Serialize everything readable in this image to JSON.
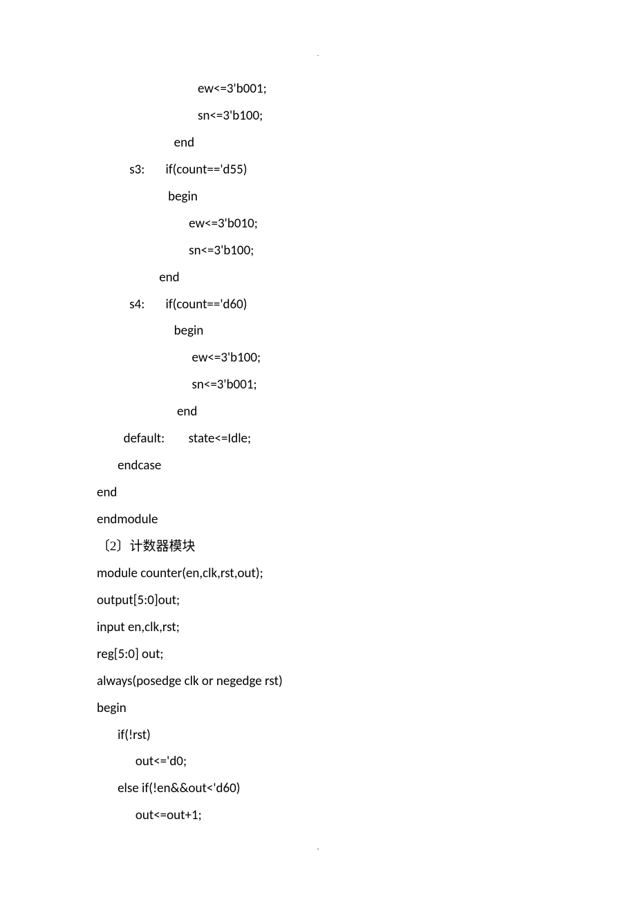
{
  "marks": {
    "top": ".",
    "bottom": "-"
  },
  "lines": [
    "                                  ew<=3'b001;",
    "                                  sn<=3'b100;",
    "                          end",
    "           s3:       if(count=='d55)",
    "                        begin",
    "                               ew<=3'b010;",
    "                               sn<=3'b100;",
    "                     end",
    "           s4:       if(count=='d60)",
    "                          begin",
    "                                ew<=3'b100;",
    "                                sn<=3'b001;",
    "                           end",
    "         default:        state<=Idle;",
    "       endcase",
    "end",
    "",
    "endmodule",
    "〔2〕计数器模块",
    "module counter(en,clk,rst,out);",
    "output[5:0]out;",
    "input en,clk,rst;",
    "reg[5:0] out;",
    "",
    "always(posedge clk or negedge rst)",
    "begin",
    "       if(!rst)",
    "             out<='d0;",
    "       else if(!en&&out<'d60)",
    "             out<=out+1;"
  ]
}
